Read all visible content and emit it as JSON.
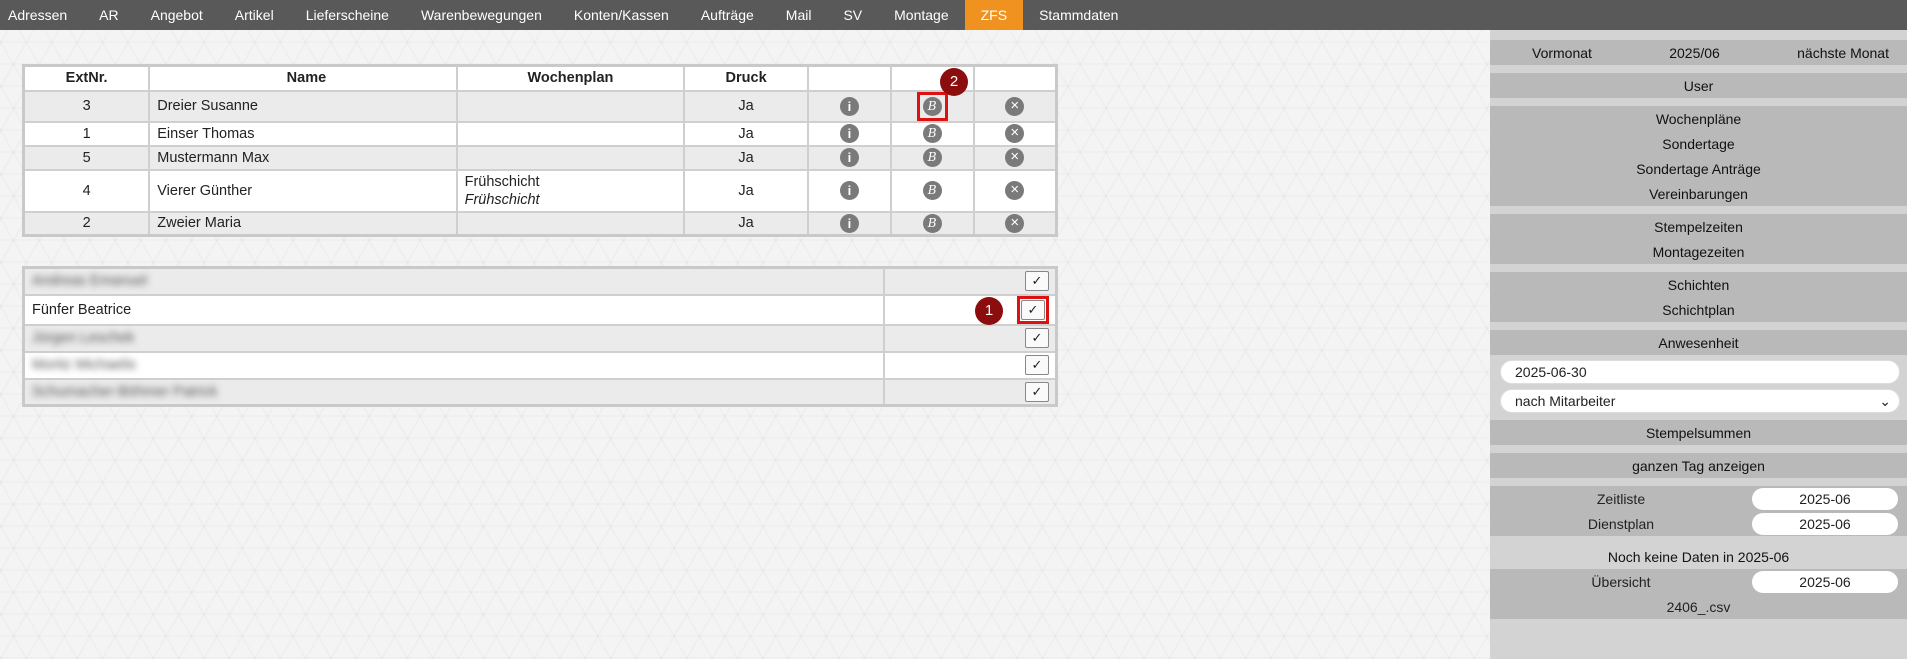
{
  "nav": {
    "items": [
      "Adressen",
      "AR",
      "Angebot",
      "Artikel",
      "Lieferscheine",
      "Warenbewegungen",
      "Konten/Kassen",
      "Aufträge",
      "Mail",
      "SV",
      "Montage",
      "ZFS",
      "Stammdaten"
    ],
    "active": "ZFS",
    "active_color": "#f0921f"
  },
  "employees": {
    "headers": {
      "ext": "ExtNr.",
      "name": "Name",
      "week": "Wochenplan",
      "print": "Druck"
    },
    "rows": [
      {
        "ext": "3",
        "name": "Dreier Susanne",
        "week1": "",
        "week2": "",
        "print": "Ja"
      },
      {
        "ext": "1",
        "name": "Einser Thomas",
        "week1": "",
        "week2": "",
        "print": "Ja"
      },
      {
        "ext": "5",
        "name": "Mustermann Max",
        "week1": "",
        "week2": "",
        "print": "Ja"
      },
      {
        "ext": "4",
        "name": "Vierer Günther",
        "week1": "Frühschicht",
        "week2": "Frühschicht",
        "print": "Ja"
      },
      {
        "ext": "2",
        "name": "Zweier Maria",
        "week1": "",
        "week2": "",
        "print": "Ja"
      }
    ],
    "icons": {
      "info": "info-icon",
      "b": "b-circle-icon",
      "delete": "close-circle-icon"
    }
  },
  "people_list": {
    "rows": [
      {
        "name": "Andreas Emanuel",
        "blurred": true,
        "check": "✓"
      },
      {
        "name": "Fünfer Beatrice",
        "blurred": false,
        "check": "✓"
      },
      {
        "name": "Jürgen Leschek",
        "blurred": true,
        "check": "✓"
      },
      {
        "name": "Moritz Michaelis",
        "blurred": true,
        "check": "✓"
      },
      {
        "name": "Schumacher-Böhmer Patrick",
        "blurred": true,
        "check": "✓"
      }
    ]
  },
  "markers": {
    "one": "1",
    "two": "2"
  },
  "sidebar": {
    "prev_month": "Vormonat",
    "current_month": "2025/06",
    "next_month": "nächste Monat",
    "user": "User",
    "plans": [
      "Wochenpläne",
      "Sondertage",
      "Sondertage Anträge",
      "Vereinbarungen"
    ],
    "times": [
      "Stempelzeiten",
      "Montagezeiten"
    ],
    "shifts": [
      "Schichten",
      "Schichtplan"
    ],
    "presence": "Anwesenheit",
    "date_value": "2025-06-30",
    "select_value": "nach Mitarbeiter",
    "stamp_sums": "Stempelsummen",
    "full_day": "ganzen Tag anzeigen",
    "timelist_label": "Zeitliste",
    "timelist_value": "2025-06",
    "dienstplan_label": "Dienstplan",
    "dienstplan_value": "2025-06",
    "no_data": "Noch keine Daten in 2025-06",
    "overview_label": "Übersicht",
    "overview_value": "2025-06",
    "csv": "2406_.csv"
  }
}
